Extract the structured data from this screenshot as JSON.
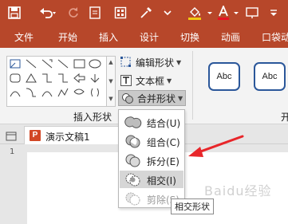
{
  "ribbon_tabs": [
    "文件",
    "开始",
    "插入",
    "设计",
    "切换",
    "动画",
    "口袋动"
  ],
  "ribbon": {
    "edit_shape": "编辑形状",
    "text_box": "文本框",
    "merge_shapes": "合并形状",
    "shape_style_sample": "Abc",
    "insert_shapes_group": "插入形状",
    "second_group_fragment": "开"
  },
  "document": {
    "tab_title": "演示文稿1",
    "close_glyph": "×",
    "app_icon_letter": "P",
    "slide_number": "1"
  },
  "merge_menu": {
    "items": [
      {
        "label": "结合(U)",
        "enabled": true
      },
      {
        "label": "组合(C)",
        "enabled": true
      },
      {
        "label": "拆分(E)",
        "enabled": true
      },
      {
        "label": "相交(I)",
        "enabled": true,
        "hovered": true
      },
      {
        "label": "剪除(S)",
        "enabled": false
      }
    ]
  },
  "tooltip": "相交形状",
  "watermark": "Baidu经验",
  "colors": {
    "accent": "#b7472a",
    "annotation_arrow": "#e8262a",
    "style_border": "#2b579a"
  },
  "icons": [
    "save-icon",
    "undo-icon",
    "redo-icon",
    "new-slide-icon",
    "eyedropper-icon",
    "shape-fill-icon",
    "font-color-icon",
    "slideshow-icon"
  ]
}
